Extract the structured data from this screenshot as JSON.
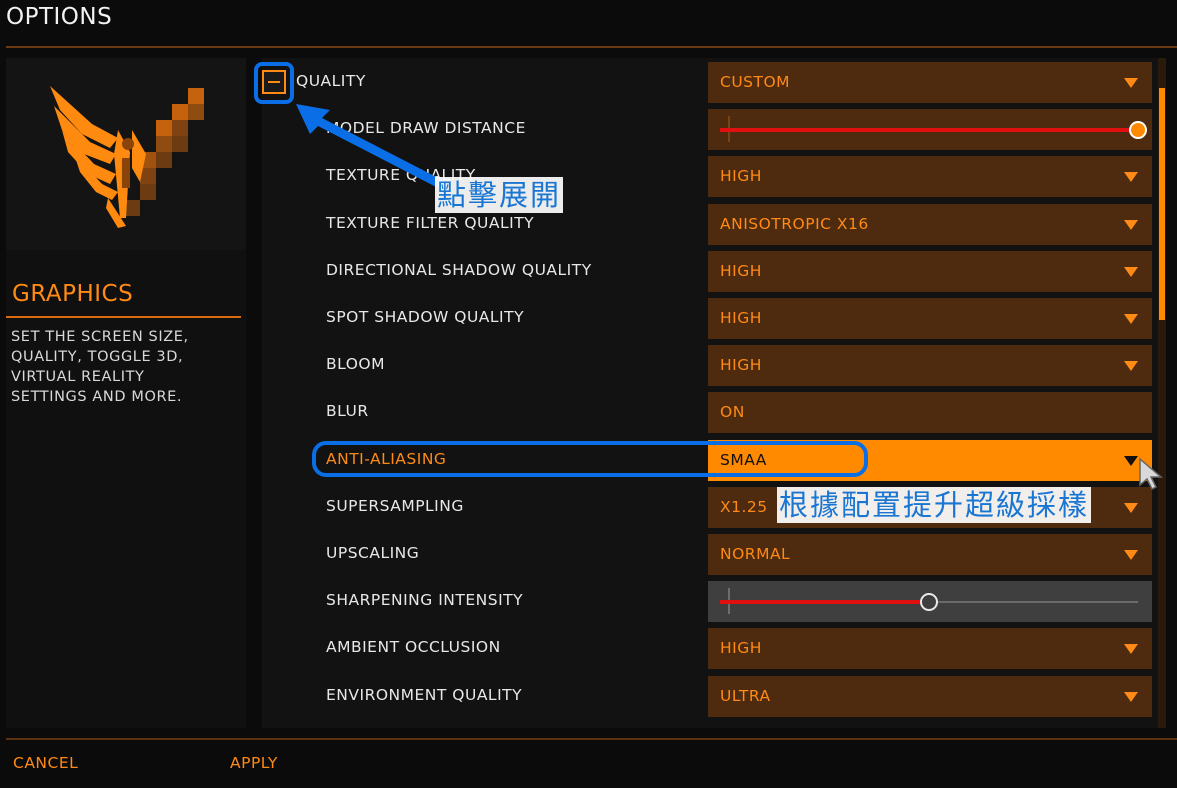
{
  "window": {
    "title": "OPTIONS"
  },
  "sidebar": {
    "section_title": "GRAPHICS",
    "section_desc": "SET THE SCREEN SIZE,\nQUALITY, TOGGLE 3D,\nVIRTUAL REALITY\nSETTINGS AND MORE."
  },
  "settings": {
    "rows": [
      {
        "label": "QUALITY",
        "control": "dropdown",
        "value": "CUSTOM",
        "category": true
      },
      {
        "label": "MODEL DRAW DISTANCE",
        "control": "slider",
        "level": 1.0
      },
      {
        "label": "TEXTURE QUALITY",
        "control": "dropdown",
        "value": "HIGH"
      },
      {
        "label": "TEXTURE FILTER QUALITY",
        "control": "dropdown",
        "value": "ANISOTROPIC X16"
      },
      {
        "label": "DIRECTIONAL SHADOW QUALITY",
        "control": "dropdown",
        "value": "HIGH"
      },
      {
        "label": "SPOT SHADOW QUALITY",
        "control": "dropdown",
        "value": "HIGH"
      },
      {
        "label": "BLOOM",
        "control": "dropdown",
        "value": "HIGH"
      },
      {
        "label": "BLUR",
        "control": "toggle",
        "value": "ON"
      },
      {
        "label": "ANTI-ALIASING",
        "control": "dropdown",
        "value": "SMAA",
        "active": true
      },
      {
        "label": "SUPERSAMPLING",
        "control": "dropdown",
        "value": "X1.25"
      },
      {
        "label": "UPSCALING",
        "control": "dropdown",
        "value": "NORMAL"
      },
      {
        "label": "SHARPENING INTENSITY",
        "control": "slider",
        "level": 0.5,
        "disabled": true
      },
      {
        "label": "AMBIENT OCCLUSION",
        "control": "dropdown",
        "value": "HIGH"
      },
      {
        "label": "ENVIRONMENT QUALITY",
        "control": "dropdown",
        "value": "ULTRA"
      }
    ]
  },
  "footer": {
    "cancel_label": "CANCEL",
    "apply_label": "APPLY"
  },
  "annotations": {
    "expand_note": "點擊展開",
    "supersampling_note": "根據配置提升超級採樣"
  },
  "colors": {
    "accent": "#ff8a00",
    "box": "#4e2a0e",
    "slider_fill": "#e01010",
    "annotation": "#0a6fe6"
  }
}
